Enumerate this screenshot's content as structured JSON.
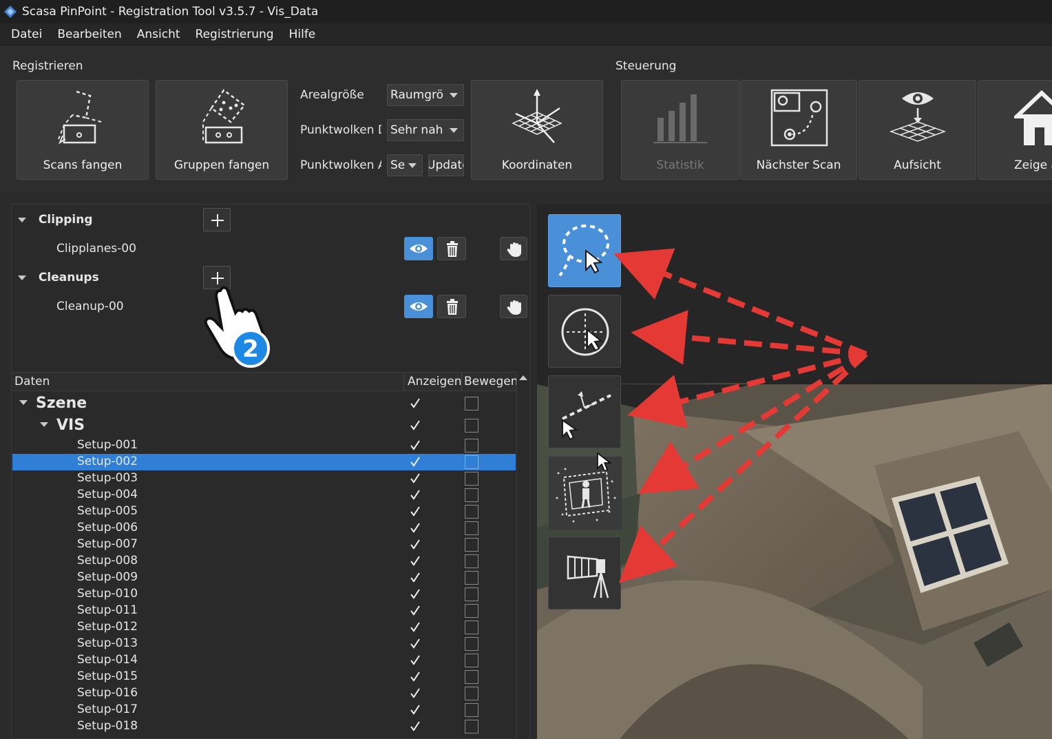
{
  "window": {
    "title": "Scasa PinPoint - Registration Tool v3.5.7 - Vis_Data"
  },
  "menu": [
    "Datei",
    "Bearbeiten",
    "Ansicht",
    "Registrierung",
    "Hilfe"
  ],
  "ribbon": {
    "registrieren": {
      "label": "Registrieren",
      "scans_fangen": "Scans fangen",
      "gruppen_fangen": "Gruppen fangen",
      "arealgroesse_label": "Arealgröße",
      "arealgroesse_value": "Raumgrö",
      "pw_detail_label": "Punktwolken D",
      "pw_detail_value": "Sehr nah",
      "pw_anzeige_label": "Punktwolken A",
      "pw_anzeige_value": "Se",
      "update_label": "Update",
      "koordinaten": "Koordinaten"
    },
    "steuerung": {
      "label": "Steuerung",
      "statistik": "Statistik",
      "naechster_scan": "Nächster Scan",
      "aufsicht": "Aufsicht",
      "zeige": "Zeige a"
    }
  },
  "clipping": {
    "header": "Clipping",
    "item": "Clipplanes-00"
  },
  "cleanups": {
    "header": "Cleanups",
    "item": "Cleanup-00"
  },
  "callout_number": "2",
  "table": {
    "columns": [
      "Daten",
      "Anzeigen",
      "Bewegen"
    ],
    "scene": "Szene",
    "group": "VIS",
    "rows": [
      {
        "name": "Setup-001",
        "show": true,
        "move": false
      },
      {
        "name": "Setup-002",
        "show": true,
        "move": false,
        "selected": true
      },
      {
        "name": "Setup-003",
        "show": true,
        "move": false
      },
      {
        "name": "Setup-004",
        "show": true,
        "move": false
      },
      {
        "name": "Setup-005",
        "show": true,
        "move": false
      },
      {
        "name": "Setup-006",
        "show": true,
        "move": false
      },
      {
        "name": "Setup-007",
        "show": true,
        "move": false
      },
      {
        "name": "Setup-008",
        "show": true,
        "move": false
      },
      {
        "name": "Setup-009",
        "show": true,
        "move": false
      },
      {
        "name": "Setup-010",
        "show": true,
        "move": false
      },
      {
        "name": "Setup-011",
        "show": true,
        "move": false
      },
      {
        "name": "Setup-012",
        "show": true,
        "move": false
      },
      {
        "name": "Setup-013",
        "show": true,
        "move": false
      },
      {
        "name": "Setup-014",
        "show": true,
        "move": false
      },
      {
        "name": "Setup-015",
        "show": true,
        "move": false
      },
      {
        "name": "Setup-016",
        "show": true,
        "move": false
      },
      {
        "name": "Setup-017",
        "show": true,
        "move": false
      },
      {
        "name": "Setup-018",
        "show": true,
        "move": false
      }
    ]
  },
  "tools": [
    "lasso-select-icon",
    "circle-select-icon",
    "line-select-icon",
    "scan-select-icon",
    "scanner-view-icon"
  ],
  "colors": {
    "accent": "#4a90d9",
    "selection": "#2f7fd6",
    "arrow": "#e53935"
  }
}
